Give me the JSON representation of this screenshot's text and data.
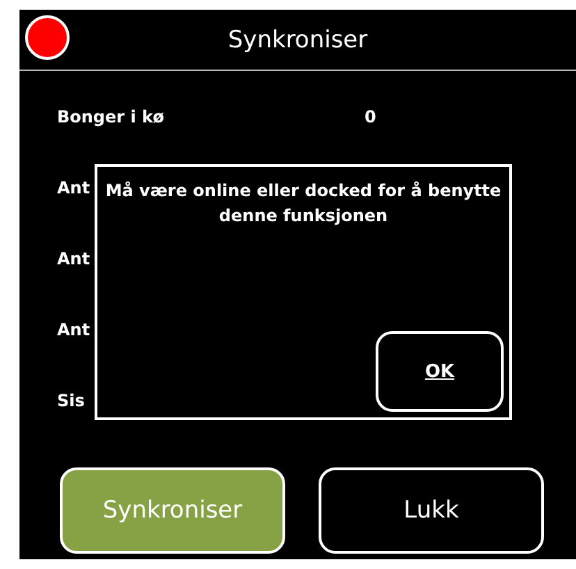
{
  "window": {
    "title": "Synkroniser",
    "online": false
  },
  "rows": [
    {
      "label": "Bonger i kø",
      "value": "0"
    },
    {
      "label": "Ant"
    },
    {
      "label": "Ant"
    },
    {
      "label": "Ant"
    },
    {
      "label": "Sis"
    }
  ],
  "dialog": {
    "message": "Må være online eller docked for å benytte denne funksjonen",
    "button": "OK"
  },
  "buttons": [
    {
      "label": "Synkroniser",
      "primary": true
    },
    {
      "label": "Lukk",
      "primary": false
    }
  ]
}
